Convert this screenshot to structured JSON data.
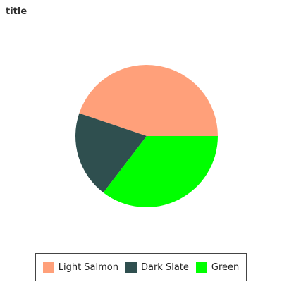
{
  "chart_data": {
    "type": "pie",
    "title": "title",
    "slices": [
      {
        "label": "Light Salmon",
        "value": 44.8,
        "color": "#FFA07A"
      },
      {
        "label": "Dark Slate",
        "value": 19.8,
        "color": "#2F4F4F"
      },
      {
        "label": "Green",
        "value": 35.4,
        "color": "#00FF00"
      }
    ],
    "start": "3 o'clock, counterclockwise",
    "legend_position": "bottom"
  }
}
